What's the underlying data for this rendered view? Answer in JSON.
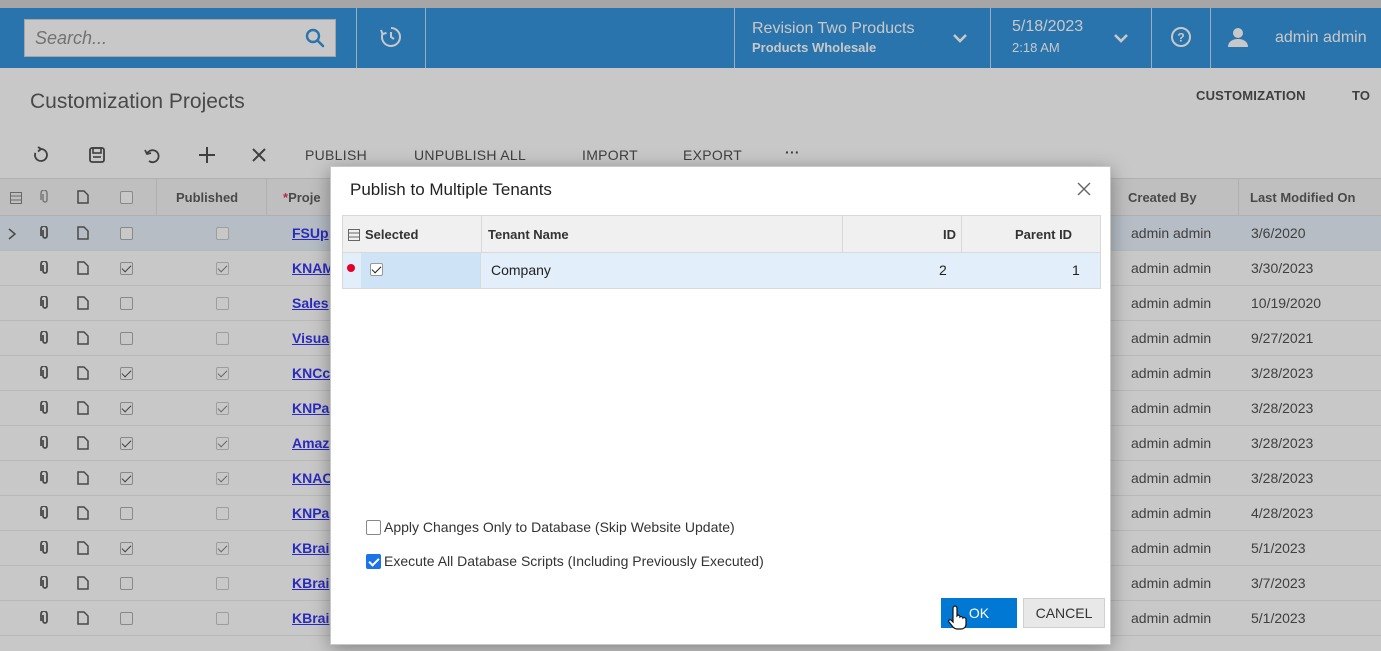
{
  "topbar": {
    "search_placeholder": "Search...",
    "company": "Revision Two Products",
    "branch": "Products Wholesale",
    "date": "5/18/2023",
    "time": "2:18 AM",
    "user": "admin admin",
    "accent": "#0078d4"
  },
  "page": {
    "title": "Customization Projects",
    "links": [
      "CUSTOMIZATION",
      "TO"
    ]
  },
  "toolbar": {
    "icons": [
      "refresh-icon",
      "save-icon",
      "undo-icon",
      "add-icon",
      "delete-icon"
    ],
    "actions": [
      "PUBLISH",
      "UNPUBLISH ALL",
      "IMPORT",
      "EXPORT",
      "···"
    ]
  },
  "grid": {
    "columns": {
      "published": "Published",
      "project": "Proje",
      "created_by": "Created By",
      "last_modified": "Last Modified On"
    },
    "rows": [
      {
        "checked": false,
        "published": false,
        "project": "FSUp",
        "created_by": "admin admin",
        "modified": "3/6/2020"
      },
      {
        "checked": true,
        "published": true,
        "project": "KNAM",
        "created_by": "admin admin",
        "modified": "3/30/2023"
      },
      {
        "checked": false,
        "published": false,
        "project": "Sales",
        "created_by": "admin admin",
        "modified": "10/19/2020"
      },
      {
        "checked": false,
        "published": false,
        "project": "Visua",
        "created_by": "admin admin",
        "modified": "9/27/2021"
      },
      {
        "checked": true,
        "published": true,
        "project": "KNCc",
        "created_by": "admin admin",
        "modified": "3/28/2023"
      },
      {
        "checked": true,
        "published": true,
        "project": "KNPa",
        "created_by": "admin admin",
        "modified": "3/28/2023"
      },
      {
        "checked": true,
        "published": true,
        "project": "Amaz",
        "created_by": "admin admin",
        "modified": "3/28/2023"
      },
      {
        "checked": true,
        "published": true,
        "project": "KNAC",
        "created_by": "admin admin",
        "modified": "3/28/2023"
      },
      {
        "checked": false,
        "published": false,
        "project": "KNPa",
        "created_by": "admin admin",
        "modified": "4/28/2023"
      },
      {
        "checked": true,
        "published": true,
        "project": "KBrai",
        "created_by": "admin admin",
        "modified": "5/1/2023"
      },
      {
        "checked": false,
        "published": false,
        "project": "KBrai",
        "created_by": "admin admin",
        "modified": "3/7/2023"
      },
      {
        "checked": false,
        "published": false,
        "project": "KBrai",
        "created_by": "admin admin",
        "modified": "5/1/2023"
      }
    ]
  },
  "dialog": {
    "title": "Publish to Multiple Tenants",
    "columns": {
      "selected": "Selected",
      "tenant": "Tenant Name",
      "id": "ID",
      "parent": "Parent ID"
    },
    "rows": [
      {
        "selected": true,
        "tenant": "Company",
        "id": "2",
        "parent": "1"
      }
    ],
    "option_apply_only_db": "Apply Changes Only to Database (Skip Website Update)",
    "option_apply_only_db_checked": false,
    "option_execute_all": "Execute All Database Scripts (Including Previously Executed)",
    "option_execute_all_checked": true,
    "ok_label": "OK",
    "cancel_label": "CANCEL"
  }
}
